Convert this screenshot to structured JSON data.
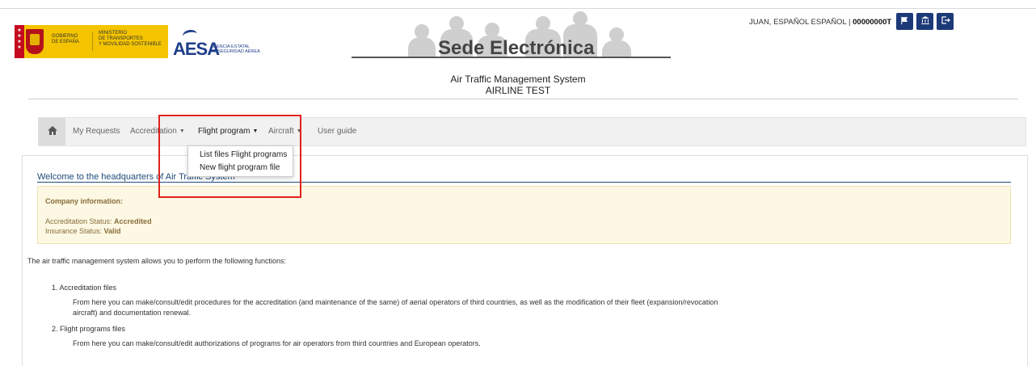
{
  "header": {
    "gov_lines": [
      "GOBIERNO",
      "DE ESPAÑA"
    ],
    "ministry_lines": [
      "MINISTERIO",
      "DE TRANSPORTES",
      "Y MOVILIDAD SOSTENIBLE"
    ],
    "aesa_name": "AESA",
    "aesa_sub": [
      "AGENCIA ESTATAL",
      "DE SEGURIDAD AÉREA"
    ],
    "sede_title": "Sede Electrónica",
    "user_name": "JUAN, ESPAÑOL ESPAÑOL",
    "user_sep": " | ",
    "user_id": "00000000T",
    "buttons": {
      "flag": "flag-icon",
      "bank": "bank-icon",
      "logout": "logout-icon"
    }
  },
  "system": {
    "title": "Air Traffic Management System",
    "company": "AIRLINE TEST"
  },
  "nav": {
    "home_icon": "home-icon",
    "items": [
      {
        "label": "My Requests",
        "caret": false
      },
      {
        "label": "Accreditation",
        "caret": true
      },
      {
        "label": "Flight program",
        "caret": true
      },
      {
        "label": "Aircraft",
        "caret": true
      },
      {
        "label": "User guide",
        "caret": false
      }
    ],
    "dropdown": [
      "List files Flight programs",
      "New flight program file"
    ]
  },
  "welcome": {
    "title": "Welcome to the headquarters of Air Traffic System"
  },
  "company_info": {
    "title": "Company information:",
    "accreditation_label": "Accreditation Status: ",
    "accreditation_value": "Accredited",
    "insurance_label": "Insurance Status: ",
    "insurance_value": "Valid"
  },
  "content": {
    "intro": "The air traffic management system allows you to perform the following functions:",
    "item1_title": "1. Accreditation files",
    "item1_desc_1": "From here you can make/consult/edit procedures for the accreditation (and maintenance of the same) of aerial operators of third countries, as well as the modification of their fleet (expansion/revocation",
    "item1_desc_2": "aircraft) and documentation renewal.",
    "item2_title": "2. Flight programs files",
    "item2_desc": "From here you can make/consult/edit authorizations of programs for air operators from third countries and European operators."
  },
  "colors": {
    "accent": "#1c3a78",
    "highlight": "#e0211b",
    "info_bg": "#fcf8e3",
    "info_text": "#8a6d3b"
  }
}
